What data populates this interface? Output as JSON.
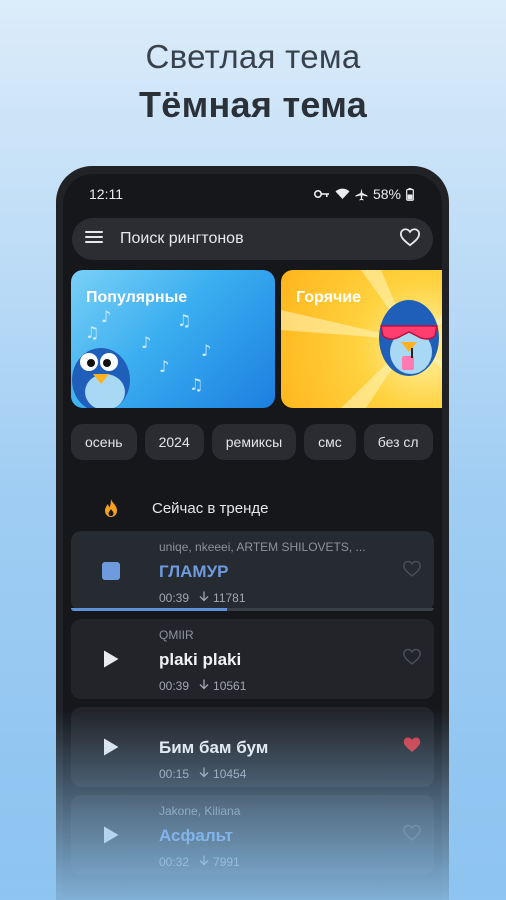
{
  "promo": {
    "light_label": "Светлая тема",
    "dark_label": "Тёмная тема"
  },
  "status": {
    "time": "12:11",
    "battery": "58%"
  },
  "search": {
    "label": "Поиск рингтонов"
  },
  "categories": [
    {
      "title": "Популярные"
    },
    {
      "title": "Горячие"
    }
  ],
  "chips": [
    "осень",
    "2024",
    "ремиксы",
    "смс",
    "без сл"
  ],
  "trending": {
    "label": "Сейчас в тренде"
  },
  "tracks": [
    {
      "artist": "uniqe, nkeeei, ARTEM SHILOVETS, ...",
      "title": "ГЛАМУР",
      "duration": "00:39",
      "downloads": "11781",
      "state": "playing",
      "liked": false,
      "progress": 0.43
    },
    {
      "artist": "QMIIR",
      "title": "plaki plaki",
      "duration": "00:39",
      "downloads": "10561",
      "state": "paused",
      "liked": false
    },
    {
      "artist": "",
      "title": "Бим бам бум",
      "duration": "00:15",
      "downloads": "10454",
      "state": "paused",
      "liked": true
    },
    {
      "artist": "Jakone, Kiliana",
      "title": "Асфальт",
      "duration": "00:32",
      "downloads": "7991",
      "state": "paused",
      "liked": false
    }
  ],
  "colors": {
    "accent": "#6e9bde",
    "heart_liked": "#d7373f",
    "background": "#16171b"
  }
}
